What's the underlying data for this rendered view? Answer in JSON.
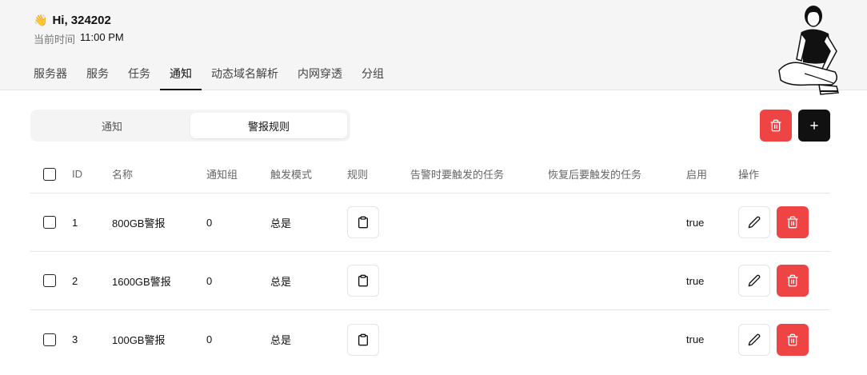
{
  "header": {
    "greeting": "Hi, 324202",
    "time_label": "当前时间",
    "time_value": "11:00 PM"
  },
  "nav": {
    "items": [
      {
        "label": "服务器",
        "active": false
      },
      {
        "label": "服务",
        "active": false
      },
      {
        "label": "任务",
        "active": false
      },
      {
        "label": "通知",
        "active": true
      },
      {
        "label": "动态域名解析",
        "active": false
      },
      {
        "label": "内网穿透",
        "active": false
      },
      {
        "label": "分组",
        "active": false
      }
    ]
  },
  "segment": {
    "notify": "通知",
    "alert_rules": "警报规则",
    "active": "alert_rules"
  },
  "table": {
    "columns": {
      "id": "ID",
      "name": "名称",
      "notify_group": "通知组",
      "trigger_mode": "触发模式",
      "rules": "规则",
      "alert_task": "告警时要触发的任务",
      "recover_task": "恢复后要触发的任务",
      "enabled": "启用",
      "actions": "操作"
    },
    "rows": [
      {
        "id": "1",
        "name": "800GB警报",
        "notify_group": "0",
        "trigger_mode": "总是",
        "alert_task": "",
        "recover_task": "",
        "enabled": "true"
      },
      {
        "id": "2",
        "name": "1600GB警报",
        "notify_group": "0",
        "trigger_mode": "总是",
        "alert_task": "",
        "recover_task": "",
        "enabled": "true"
      },
      {
        "id": "3",
        "name": "100GB警报",
        "notify_group": "0",
        "trigger_mode": "总是",
        "alert_task": "",
        "recover_task": "",
        "enabled": "true"
      }
    ]
  },
  "colors": {
    "danger": "#ef4444",
    "primary": "#111111"
  }
}
